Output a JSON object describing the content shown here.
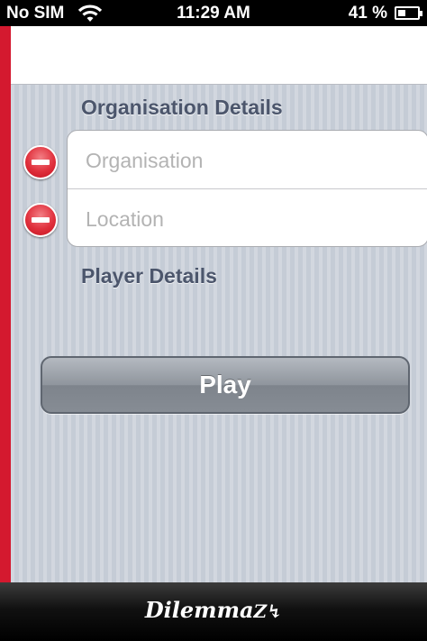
{
  "status_bar": {
    "carrier": "No SIM",
    "time": "11:29 AM",
    "battery_percent": "41 %",
    "battery_level": 0.41
  },
  "sections": {
    "organisation": {
      "title": "Organisation Details"
    },
    "player": {
      "title": "Player Details"
    }
  },
  "fields": {
    "organisation": {
      "placeholder": "Organisation",
      "value": ""
    },
    "location": {
      "placeholder": "Location",
      "value": ""
    }
  },
  "play_button": {
    "label": "Play"
  },
  "footer": {
    "logo_text": "Dilemma",
    "logo_accent": "Z",
    "logo_accent_glyph": "↯"
  },
  "colors": {
    "accent_red": "#d4192f",
    "section_header": "#4c566c",
    "background": "#c5ccd6"
  }
}
